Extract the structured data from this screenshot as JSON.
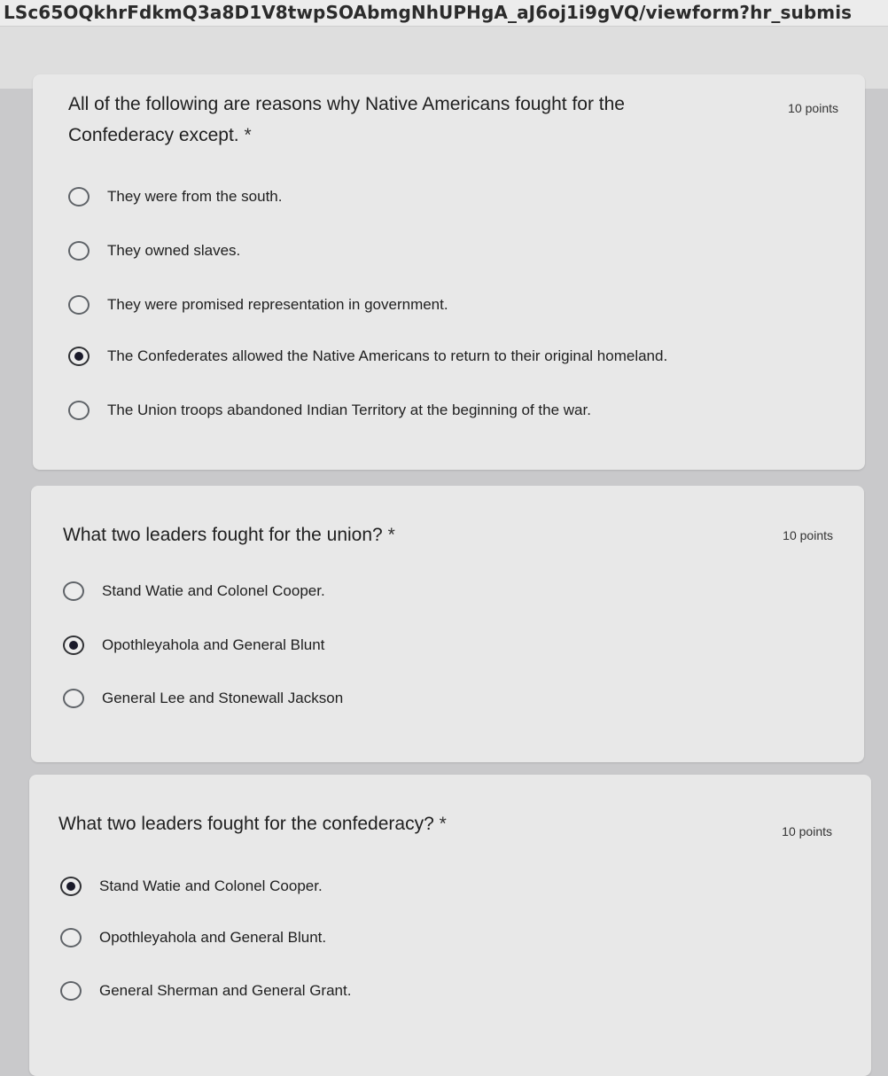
{
  "browser": {
    "url": "LSc65OQkhrFdkmQ3a8D1V8twpSOAbmgNhUPHgA_aJ6oj1i9gVQ/viewform?hr_submis"
  },
  "questions": [
    {
      "text": "All of the following are reasons why Native Americans fought for the Confederacy except.",
      "required_mark": "*",
      "points": "10 points",
      "selected_index": 3,
      "options": [
        "They were from the south.",
        "They owned slaves.",
        "They were promised representation in government.",
        "The Confederates allowed the Native Americans to return to their original homeland.",
        "The Union troops abandoned Indian Territory at the beginning of the war."
      ]
    },
    {
      "text": "What two leaders fought for the union?",
      "required_mark": "*",
      "points": "10 points",
      "selected_index": 1,
      "options": [
        "Stand Watie and Colonel Cooper.",
        "Opothleyahola and General Blunt",
        "General Lee and Stonewall Jackson"
      ]
    },
    {
      "text": "What two leaders fought for the confederacy?",
      "required_mark": "*",
      "points": "10 points",
      "selected_index": 0,
      "options": [
        "Stand Watie and Colonel Cooper.",
        "Opothleyahola and General Blunt.",
        "General Sherman and General Grant."
      ]
    }
  ]
}
